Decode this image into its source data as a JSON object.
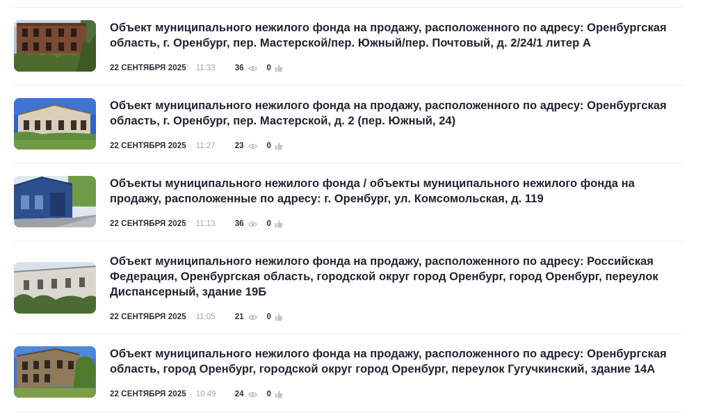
{
  "news": [
    {
      "title": "Объект муниципального нежилого фонда на продажу, расположенного по адресу: Оренбургская область, г. Оренбург, пер. Мастерской/пер. Южный/пер. Почтовый, д. 2/24/1 литер А",
      "date": "22 СЕНТЯБРЯ 2025",
      "time": "11:33",
      "views": "36",
      "likes": "0",
      "image": "abandoned-brick-building-photo"
    },
    {
      "title": "Объект муниципального нежилого фонда на продажу, расположенного по адресу: Оренбургская область, г. Оренбург, пер. Мастерской, д. 2 (пер. Южный, 24)",
      "date": "22 СЕНТЯБРЯ 2025",
      "time": "11:27",
      "views": "23",
      "likes": "0",
      "image": "ruined-house-photo"
    },
    {
      "title": "Объекты муниципального нежилого фонда / объекты муниципального нежилого фонда на продажу, расположенные по адресу: г. Оренбург, ул. Комсомольская, д. 119",
      "date": "22 СЕНТЯБРЯ 2025",
      "time": "11:13",
      "views": "36",
      "likes": "0",
      "image": "blue-wooden-house-photo"
    },
    {
      "title": "Объект муниципального нежилого фонда на продажу, расположенного по адресу: Российская Федерация, Оренбургская область, городской округ город Оренбург, город Оренбург, переулок Диспансерный, здание 19Б",
      "date": "22 СЕНТЯБРЯ 2025",
      "time": "11:05",
      "views": "21",
      "likes": "0",
      "image": "white-brick-building-photo"
    },
    {
      "title": "Объект муниципального нежилого фонда на продажу, расположенного по адресу: Оренбургская область, город Оренбург, городской округ город Оренбург, переулок Гугучкинский, здание 14А",
      "date": "22 СЕНТЯБРЯ 2025",
      "time": "10:49",
      "views": "24",
      "likes": "0",
      "image": "old-house-with-tree-photo"
    }
  ],
  "colors": {
    "title": "#1f2230",
    "meta_muted": "#a1a5b0",
    "divider": "#eceef2"
  }
}
